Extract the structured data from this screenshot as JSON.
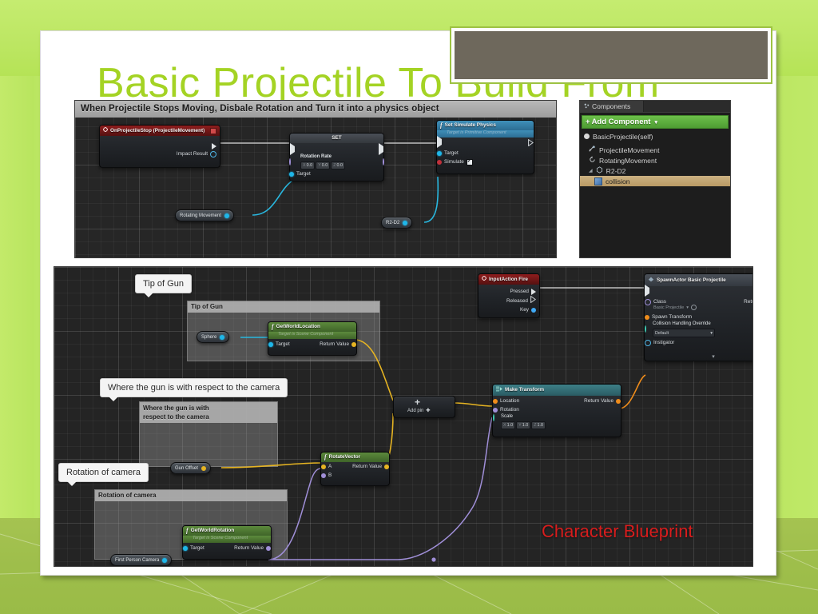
{
  "slide": {
    "title": "Basic Projectile To Build From",
    "title_color": "#a4d324",
    "accent_green": "#b6e25c",
    "red_label": "Character Blueprint",
    "red_label_color": "#d81d1d"
  },
  "top_graph": {
    "comment_bar": "When Projectile Stops Moving, Disbale Rotation and Turn it into a physics object",
    "nodes": {
      "event": {
        "title": "OnProjectileStop (ProjectileMovement)",
        "out_pin": "Impact Result"
      },
      "set_node": {
        "title": "SET",
        "property": "Rotation Rate",
        "values": [
          "0.0",
          "0.0",
          "0.0"
        ],
        "axes": [
          "X",
          "Y",
          "Z"
        ],
        "target": "Target"
      },
      "simulate": {
        "title": "Set Simulate Physics",
        "subtitle": "Target is Primitive Component",
        "target": "Target",
        "simulate": "Simulate",
        "simulate_checked": true
      }
    },
    "variables": {
      "rotating_movement": "Rotating Movement",
      "r2d2": "R2-D2"
    }
  },
  "components_panel": {
    "tab_label": "Components",
    "add_button": "Add Component",
    "items": [
      {
        "label": "BasicProjectile(self)",
        "icon": "sphere-icon",
        "indent": 0,
        "selected": false
      },
      {
        "label": "ProjectileMovement",
        "icon": "movement-icon",
        "indent": 1,
        "selected": false
      },
      {
        "label": "RotatingMovement",
        "icon": "rotation-icon",
        "indent": 1,
        "selected": false
      },
      {
        "label": "R2-D2",
        "icon": "mesh-icon",
        "indent": 1,
        "selected": false
      },
      {
        "label": "collision",
        "icon": "collision-icon",
        "indent": 2,
        "selected": true
      }
    ]
  },
  "bottom_graph": {
    "callouts": [
      "Tip of Gun",
      "Where the gun is with respect to the camera",
      "Rotation of camera"
    ],
    "comments": [
      "Tip of Gun",
      "Where the gun is with\nrespect to the camera",
      "Rotation of camera"
    ],
    "comment_titles": {
      "tip_of_gun": "Tip of Gun",
      "gun_offset": "Where the gun is with",
      "gun_offset2": "respect to the camera",
      "camera_rotation": "Rotation of camera"
    },
    "nodes": {
      "get_world_location": {
        "title": "GetWorldLocation",
        "subtitle": "Target is Scene Component",
        "in_pin": "Target",
        "out_pin": "Return Value"
      },
      "get_world_rotation": {
        "title": "GetWorldRotation",
        "subtitle": "Target is Scene Component",
        "in_pin": "Target",
        "out_pin": "Return Value"
      },
      "rotate_vector": {
        "title": "RotateVector",
        "in_a": "A",
        "in_b": "B",
        "out_pin": "Return Value"
      },
      "add_node": {
        "label": "Add pin"
      },
      "input_action_fire": {
        "title": "InputAction Fire",
        "pressed": "Pressed",
        "released": "Released",
        "key": "Key"
      },
      "make_transform": {
        "title": "Make Transform",
        "location": "Location",
        "rotation": "Rotation",
        "scale": "Scale",
        "scale_values": [
          "1.0",
          "1.0",
          "1.0"
        ],
        "axes": [
          "X",
          "Y",
          "Z"
        ],
        "out_pin": "Return Value"
      },
      "spawn_actor": {
        "title": "SpawnActor Basic Projectile",
        "class_label": "Class",
        "class_value": "Basic Projectile",
        "spawn_transform": "Spawn Transform",
        "collision_label": "Collision Handling Override",
        "collision_value": "Default",
        "instigator": "Instigator",
        "out_pin": "Return Value"
      }
    },
    "variables": {
      "sphere": "Sphere",
      "gun_offset": "Gun Offset",
      "first_person_camera": "First Person Camera"
    }
  }
}
